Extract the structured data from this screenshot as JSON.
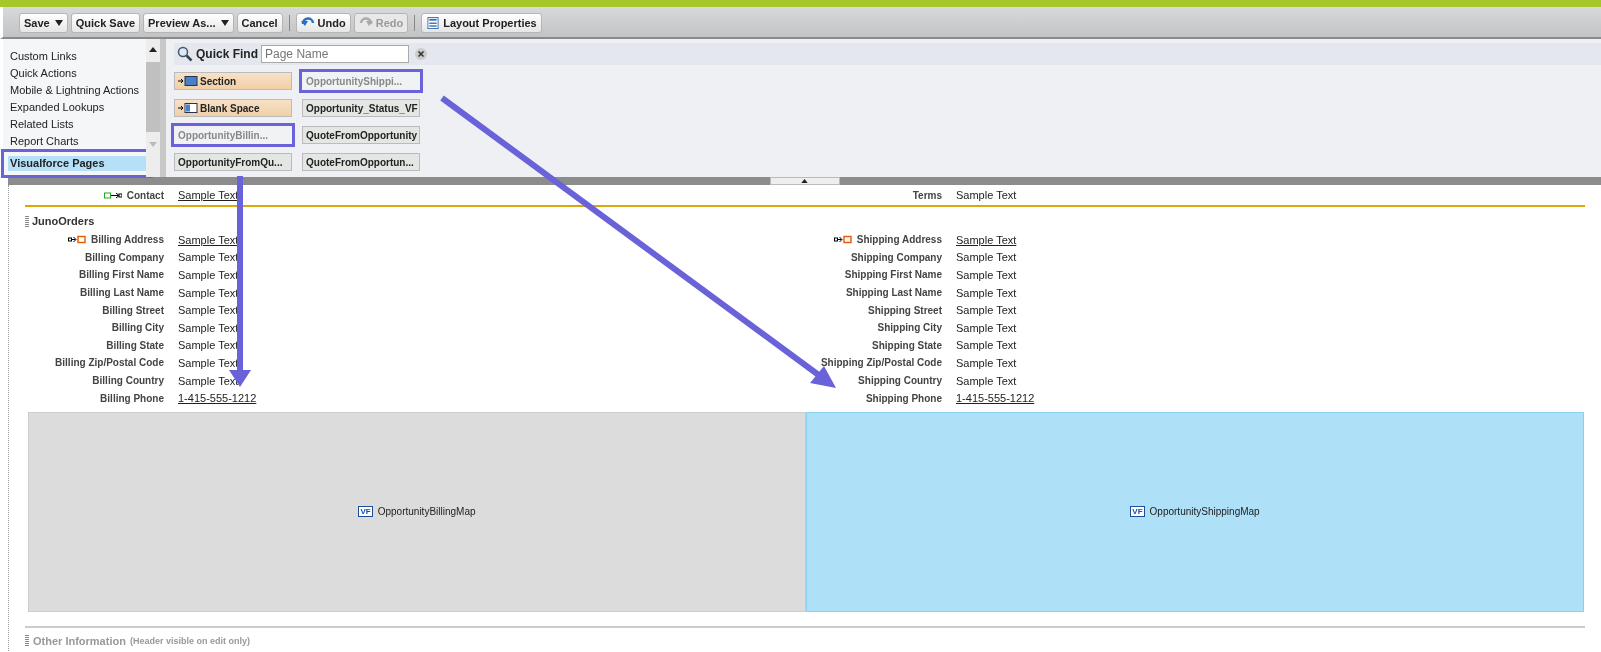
{
  "toolbar": {
    "groups": [
      {
        "buttons": [
          {
            "label": "Save",
            "kind": "text",
            "dropdown": true,
            "disabled": false
          },
          {
            "label": "Quick Save",
            "kind": "text",
            "dropdown": false,
            "disabled": false
          },
          {
            "label": "Preview As...",
            "kind": "text",
            "dropdown": true,
            "disabled": false
          },
          {
            "label": "Cancel",
            "kind": "text",
            "dropdown": false,
            "disabled": false
          }
        ]
      },
      {
        "buttons": [
          {
            "label": "Undo",
            "kind": "undo",
            "dropdown": false,
            "disabled": false
          },
          {
            "label": "Redo",
            "kind": "redo",
            "dropdown": false,
            "disabled": true
          }
        ]
      },
      {
        "buttons": [
          {
            "label": "Layout Properties",
            "kind": "layout",
            "dropdown": false,
            "disabled": false
          }
        ]
      }
    ]
  },
  "palette": {
    "categories": [
      {
        "label": "Custom Links",
        "selected": false,
        "annotated": false
      },
      {
        "label": "Quick Actions",
        "selected": false,
        "annotated": false
      },
      {
        "label": "Mobile & Lightning Actions",
        "selected": false,
        "annotated": false
      },
      {
        "label": "Expanded Lookups",
        "selected": false,
        "annotated": false
      },
      {
        "label": "Related Lists",
        "selected": false,
        "annotated": false
      },
      {
        "label": "Report Charts",
        "selected": false,
        "annotated": false
      },
      {
        "label": "Visualforce Pages",
        "selected": true,
        "annotated": true
      }
    ],
    "quick_find": {
      "label": "Quick Find",
      "placeholder": "Page Name"
    },
    "items": [
      {
        "label": "Section",
        "kind": "section",
        "used": false,
        "annotated": false
      },
      {
        "label": "OpportunityShippi...",
        "kind": "page",
        "used": true,
        "annotated": true
      },
      {
        "label": "Blank Space",
        "kind": "blank",
        "used": false,
        "annotated": false
      },
      {
        "label": "Opportunity_Status_VF",
        "kind": "page",
        "used": false,
        "annotated": false
      },
      {
        "label": "OpportunityBillin...",
        "kind": "page",
        "used": true,
        "annotated": true
      },
      {
        "label": "QuoteFromOpportunity",
        "kind": "page",
        "used": false,
        "annotated": false
      },
      {
        "label": "OpportunityFromQu...",
        "kind": "page",
        "used": false,
        "annotated": false
      },
      {
        "label": "QuoteFromOpportun...",
        "kind": "page",
        "used": false,
        "annotated": false
      }
    ]
  },
  "top_row": [
    {
      "label": "Contact",
      "value": "Sample Text",
      "kind": "lookup",
      "underlined": true
    },
    {
      "label": "Terms",
      "value": "Sample Text",
      "kind": "plain",
      "underlined": false
    }
  ],
  "section": {
    "title": "JunoOrders",
    "left": [
      {
        "label": "Billing Address",
        "value": "Sample Text",
        "kind": "required",
        "underlined": true
      },
      {
        "label": "Billing Company",
        "value": "Sample Text",
        "kind": "plain",
        "underlined": false
      },
      {
        "label": "Billing First Name",
        "value": "Sample Text",
        "kind": "plain",
        "underlined": false
      },
      {
        "label": "Billing Last Name",
        "value": "Sample Text",
        "kind": "plain",
        "underlined": false
      },
      {
        "label": "Billing Street",
        "value": "Sample Text",
        "kind": "plain",
        "underlined": false
      },
      {
        "label": "Billing City",
        "value": "Sample Text",
        "kind": "plain",
        "underlined": false
      },
      {
        "label": "Billing State",
        "value": "Sample Text",
        "kind": "plain",
        "underlined": false
      },
      {
        "label": "Billing Zip/Postal Code",
        "value": "Sample Text",
        "kind": "plain",
        "underlined": false
      },
      {
        "label": "Billing Country",
        "value": "Sample Text",
        "kind": "plain",
        "underlined": false
      },
      {
        "label": "Billing Phone",
        "value": "1-415-555-1212",
        "kind": "plain",
        "underlined": true
      }
    ],
    "right": [
      {
        "label": "Shipping Address",
        "value": "Sample Text",
        "kind": "required",
        "underlined": true
      },
      {
        "label": "Shipping Company",
        "value": "Sample Text",
        "kind": "plain",
        "underlined": false
      },
      {
        "label": "Shipping First Name",
        "value": "Sample Text",
        "kind": "plain",
        "underlined": false
      },
      {
        "label": "Shipping Last Name",
        "value": "Sample Text",
        "kind": "plain",
        "underlined": false
      },
      {
        "label": "Shipping Street",
        "value": "Sample Text",
        "kind": "plain",
        "underlined": false
      },
      {
        "label": "Shipping City",
        "value": "Sample Text",
        "kind": "plain",
        "underlined": false
      },
      {
        "label": "Shipping State",
        "value": "Sample Text",
        "kind": "plain",
        "underlined": false
      },
      {
        "label": "Shipping Zip/Postal Code",
        "value": "Sample Text",
        "kind": "plain",
        "underlined": false
      },
      {
        "label": "Shipping Country",
        "value": "Sample Text",
        "kind": "plain",
        "underlined": false
      },
      {
        "label": "Shipping Phone",
        "value": "1-415-555-1212",
        "kind": "plain",
        "underlined": true
      }
    ],
    "vf_pages": [
      {
        "badge": "VF",
        "label": "OpportunityBillingMap",
        "selected": false
      },
      {
        "badge": "VF",
        "label": "OpportunityShippingMap",
        "selected": true
      }
    ]
  },
  "next_section": {
    "title": "Other Information",
    "note": "(Header visible on edit only)"
  }
}
